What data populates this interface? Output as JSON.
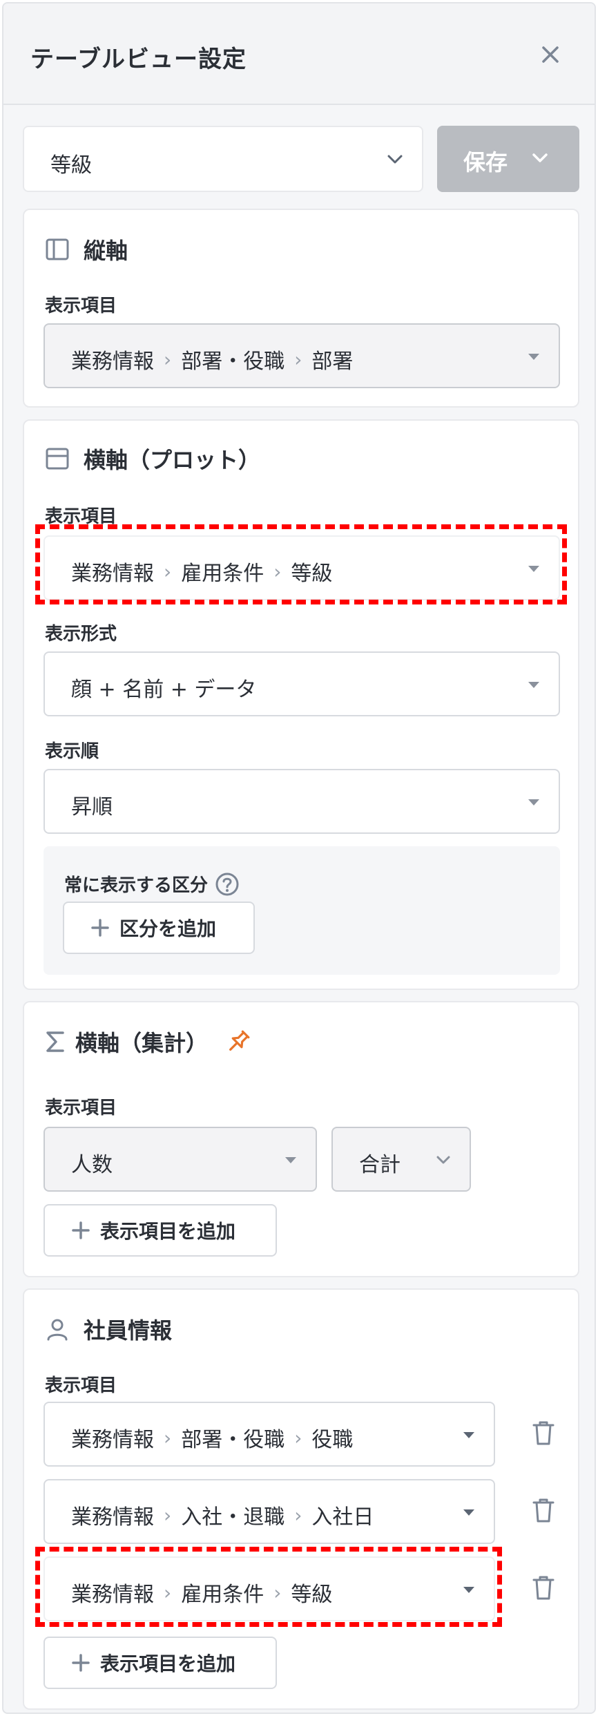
{
  "header": {
    "title": "テーブルビュー設定"
  },
  "view_select": {
    "value": "等級"
  },
  "save_button": {
    "label": "保存"
  },
  "vertical_axis": {
    "title": "縦軸",
    "field_label": "表示項目",
    "field": [
      "業務情報",
      "部署・役職",
      "部署"
    ]
  },
  "horizontal_plot": {
    "title": "横軸（プロット）",
    "field_label": "表示項目",
    "field": [
      "業務情報",
      "雇用条件",
      "等級"
    ],
    "format_label": "表示形式",
    "format_value": "顔 + 名前 + データ",
    "order_label": "表示順",
    "order_value": "昇順",
    "always_show_label": "常に表示する区分",
    "add_division": "区分を追加"
  },
  "horizontal_aggregate": {
    "title": "横軸（集計）",
    "field_label": "表示項目",
    "field_value": "人数",
    "agg_value": "合計",
    "add_item": "表示項目を追加"
  },
  "employee_info": {
    "title": "社員情報",
    "field_label": "表示項目",
    "rows": [
      [
        "業務情報",
        "部署・役職",
        "役職"
      ],
      [
        "業務情報",
        "入社・退職",
        "入社日"
      ],
      [
        "業務情報",
        "雇用条件",
        "等級"
      ]
    ],
    "add_item": "表示項目を追加"
  },
  "colors": {
    "accent_pin": "#e8742a",
    "highlight": "#ff0000",
    "icon": "#7b8594"
  }
}
